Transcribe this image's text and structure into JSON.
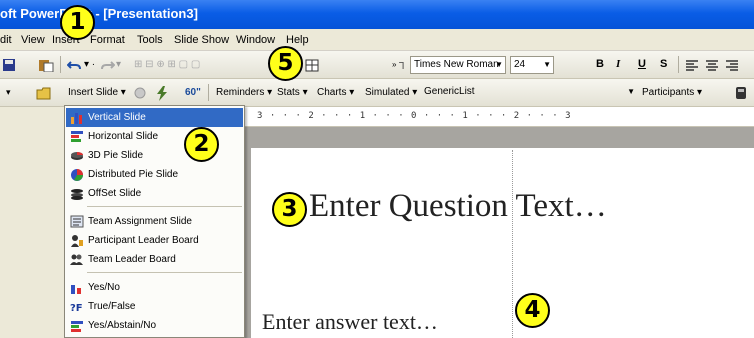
{
  "window": {
    "title": "oft PowerPoint - [Presentation3]"
  },
  "menu": {
    "items": [
      "dit",
      "View",
      "Insert",
      "Format",
      "Tools",
      "Slide Show",
      "Window",
      "Help"
    ]
  },
  "toolbar": {
    "font_name": "Times New Roman",
    "font_size": "24",
    "bold": "B",
    "italic": "I",
    "underline": "U",
    "shadow": "S"
  },
  "custom_toolbar": {
    "insert_slide": "Insert Slide",
    "reminders": "Reminders",
    "stats": "Stats",
    "charts": "Charts",
    "simulated": "Simulated",
    "list_value": "GenericList",
    "participants": "Participants"
  },
  "ruler": {
    "text": "3 · · · 2 · · · 1 · · · 0 · · · 1 · · · 2 · · · 3"
  },
  "insert_slide_menu": {
    "groups": [
      [
        "Vertical Slide",
        "Horizontal Slide",
        "3D Pie Slide",
        "Distributed Pie Slide",
        "OffSet Slide"
      ],
      [
        "Team Assignment Slide",
        "Participant Leader Board",
        "Team Leader Board"
      ],
      [
        "Yes/No",
        "True/False",
        "Yes/Abstain/No"
      ]
    ]
  },
  "slide": {
    "question_text": "Enter Question Text…",
    "answer_text": "Enter answer text…"
  },
  "callouts": [
    "1",
    "2",
    "3",
    "4",
    "5"
  ],
  "colors": {
    "titlebar": "#0a5de6",
    "menu_selection": "#316ac5",
    "callout_fill": "#ffff1a"
  }
}
